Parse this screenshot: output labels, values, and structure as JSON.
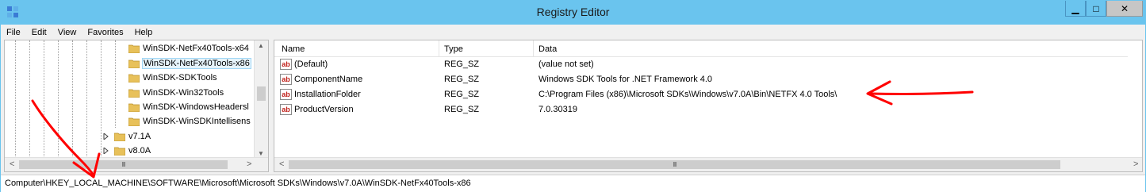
{
  "window": {
    "title": "Registry Editor",
    "icon": "registry-editor-icon"
  },
  "window_controls": {
    "minimize": "▁",
    "maximize": "□",
    "close": "✕"
  },
  "menu": [
    "File",
    "Edit",
    "View",
    "Favorites",
    "Help"
  ],
  "tree": {
    "items": [
      {
        "label": "WinSDK-NetFx40Tools-x64",
        "selected": false
      },
      {
        "label": "WinSDK-NetFx40Tools-x86",
        "selected": true
      },
      {
        "label": "WinSDK-SDKTools",
        "selected": false
      },
      {
        "label": "WinSDK-Win32Tools",
        "selected": false
      },
      {
        "label": "WinSDK-WindowsHeadersl",
        "selected": false
      },
      {
        "label": "WinSDK-WinSDKIntellisens",
        "selected": false
      },
      {
        "label": "v7.1A",
        "selected": false,
        "expandable": true
      },
      {
        "label": "v8.0A",
        "selected": false,
        "expandable": true
      }
    ],
    "scroll": {
      "grip": "III",
      "left": "<",
      "right": ">",
      "up": "▲",
      "down": "▼"
    }
  },
  "values": {
    "columns": {
      "name": "Name",
      "type": "Type",
      "data": "Data"
    },
    "rows": [
      {
        "name": "(Default)",
        "type": "REG_SZ",
        "data": "(value not set)"
      },
      {
        "name": "ComponentName",
        "type": "REG_SZ",
        "data": "Windows SDK Tools for .NET Framework 4.0"
      },
      {
        "name": "InstallationFolder",
        "type": "REG_SZ",
        "data": "C:\\Program Files (x86)\\Microsoft SDKs\\Windows\\v7.0A\\Bin\\NETFX 4.0 Tools\\"
      },
      {
        "name": "ProductVersion",
        "type": "REG_SZ",
        "data": "7.0.30319"
      }
    ],
    "row_icon": "ab",
    "scroll": {
      "grip": "III",
      "left": "<",
      "right": ">"
    }
  },
  "status": {
    "path": "Computer\\HKEY_LOCAL_MACHINE\\SOFTWARE\\Microsoft\\Microsoft SDKs\\Windows\\v7.0A\\WinSDK-NetFx40Tools-x86"
  },
  "colors": {
    "titlebar": "#6ac4ee",
    "annotation": "#ff0000",
    "folder": "#e8c15a"
  }
}
